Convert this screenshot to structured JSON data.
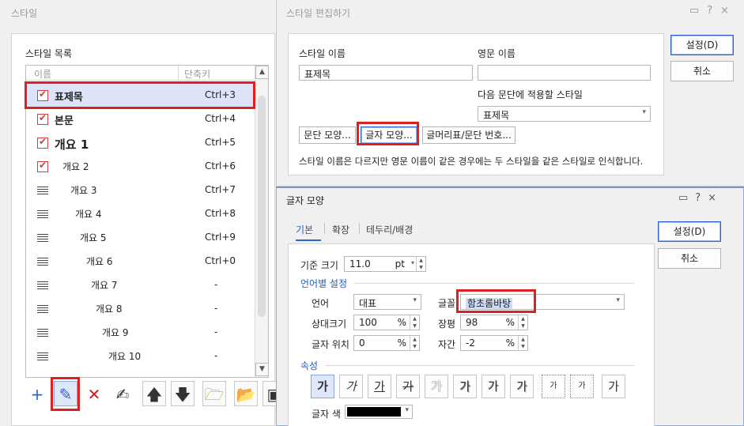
{
  "style_dialog": {
    "title": "스타일",
    "list_label": "스타일 목록",
    "columns": {
      "name": "이름",
      "shortcut": "단축키"
    },
    "rows": [
      {
        "name": "표제목",
        "shortcut": "Ctrl+3",
        "icon": "checked-style-icon",
        "selected": true
      },
      {
        "name": "본문",
        "shortcut": "Ctrl+4",
        "icon": "checked-style-icon"
      },
      {
        "name": "개요 1",
        "shortcut": "Ctrl+5",
        "icon": "checked-style-icon"
      },
      {
        "name": "개요 2",
        "shortcut": "Ctrl+6",
        "icon": "checked-style-icon"
      },
      {
        "name": "개요 3",
        "shortcut": "Ctrl+7",
        "icon": "paragraph-lines-icon"
      },
      {
        "name": "개요 4",
        "shortcut": "Ctrl+8",
        "icon": "paragraph-lines-icon"
      },
      {
        "name": "개요 5",
        "shortcut": "Ctrl+9",
        "icon": "paragraph-lines-icon"
      },
      {
        "name": "개요 6",
        "shortcut": "Ctrl+0",
        "icon": "paragraph-lines-icon"
      },
      {
        "name": "개요 7",
        "shortcut": "-",
        "icon": "paragraph-lines-icon"
      },
      {
        "name": "개요 8",
        "shortcut": "-",
        "icon": "paragraph-lines-icon"
      },
      {
        "name": "개요 9",
        "shortcut": "-",
        "icon": "paragraph-lines-icon"
      },
      {
        "name": "개요 10",
        "shortcut": "-",
        "icon": "paragraph-lines-icon"
      }
    ],
    "toolbar": [
      {
        "icon": "plus-icon",
        "glyph": "+",
        "color": "#2f63c9"
      },
      {
        "icon": "pencil-icon",
        "glyph": "✎",
        "color": "#2f63c9",
        "pressed": true
      },
      {
        "icon": "delete-x-icon",
        "glyph": "✕",
        "color": "#d02020"
      },
      {
        "icon": "edit-style-icon",
        "glyph": "✍",
        "color": "#333333"
      },
      {
        "icon": "move-up-icon",
        "glyph": "🡅",
        "color": "#333333"
      },
      {
        "icon": "move-down-icon",
        "glyph": "🡇",
        "color": "#333333"
      },
      {
        "icon": "import-icon",
        "glyph": "🗁",
        "color": "#c89a20"
      },
      {
        "icon": "folder-icon",
        "glyph": "📂",
        "color": "#c89a20"
      },
      {
        "icon": "save-icon",
        "glyph": "▣",
        "color": "#333333"
      }
    ]
  },
  "edit_dialog": {
    "title": "스타일 편집하기",
    "controls": "▭?×",
    "style_name_label": "스타일 이름",
    "style_name_value": "표제목",
    "english_name_label": "영문 이름",
    "english_name_value": "",
    "next_style_label": "다음 문단에 적용할 스타일",
    "next_style_value": "표제목",
    "para_shape_button": "문단 모양...",
    "char_shape_button": "글자 모양...",
    "bullet_button": "글머리표/문단 번호...",
    "note": "스타일 이름은 다르지만 영문 이름이 같은 경우에는 두 스타일을 같은 스타일로 인식합니다.",
    "ok": "설정(D)",
    "cancel": "취소"
  },
  "char_dialog": {
    "title": "글자 모양",
    "controls": "▭?×",
    "tabs": [
      "기본",
      "확장",
      "테두리/배경"
    ],
    "base_size_label": "기준 크기",
    "base_size_value": "11.0",
    "base_size_unit": "pt",
    "lang_section": "언어별 설정",
    "lang_label": "언어",
    "lang_value": "대표",
    "font_label": "글꼴",
    "font_value": "함초롬바탕",
    "rel_size_label": "상대크기",
    "rel_size_value": "100",
    "width_label": "장평",
    "width_value": "98",
    "position_label": "글자 위치",
    "position_value": "0",
    "spacing_label": "자간",
    "spacing_value": "-2",
    "percent": "%",
    "attr_section": "속성",
    "attr_glyph": "가",
    "attr_buttons": [
      {
        "icon": "bold-icon",
        "on": true
      },
      {
        "icon": "italic-icon"
      },
      {
        "icon": "underline-icon"
      },
      {
        "icon": "strikethrough-icon"
      },
      {
        "icon": "outline-icon"
      },
      {
        "icon": "shadow-icon"
      },
      {
        "icon": "emboss-icon"
      },
      {
        "icon": "engrave-icon"
      },
      {
        "icon": "superscript-icon"
      },
      {
        "icon": "subscript-icon"
      },
      {
        "icon": "normal-icon"
      }
    ],
    "color_label": "글자 색",
    "color_value": "#000000",
    "ok": "설정(D)",
    "cancel": "취소"
  }
}
